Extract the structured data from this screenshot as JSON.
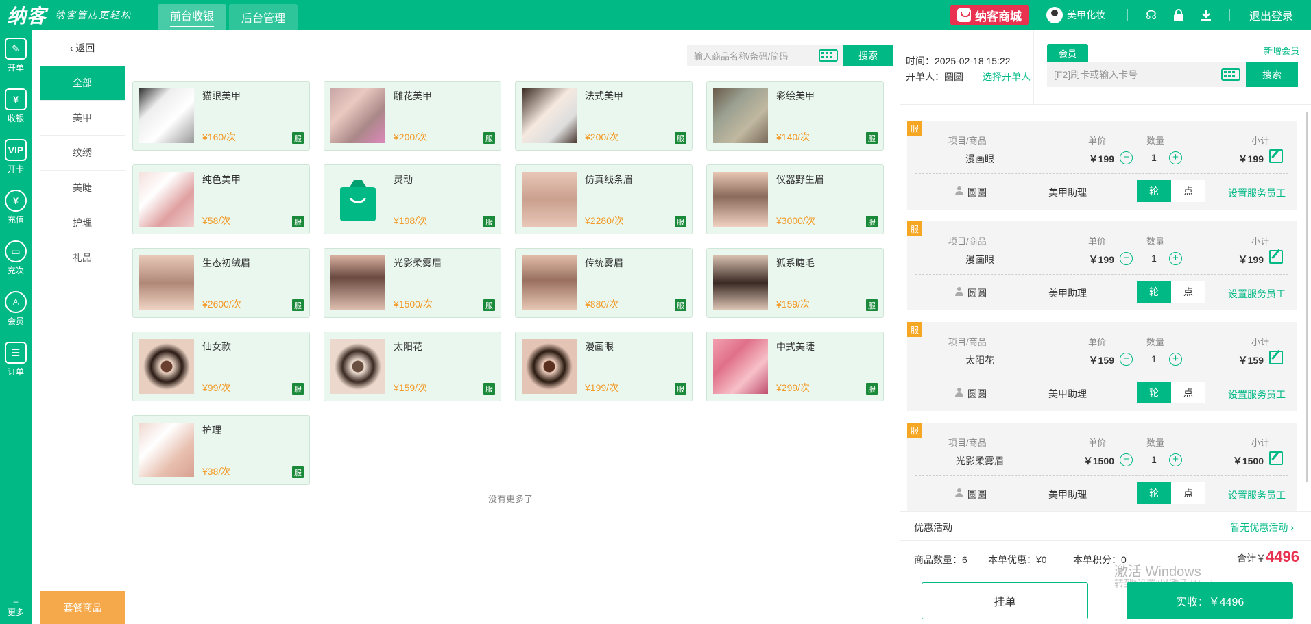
{
  "header": {
    "brand": "纳客",
    "slogan": "纳客管店更轻松",
    "tabs": [
      "前台收银",
      "后台管理"
    ],
    "mall": "纳客商城",
    "user": "美甲化妆",
    "logout": "退出登录"
  },
  "nav": [
    "开单",
    "收银",
    "开卡",
    "充值",
    "充次",
    "会员",
    "订单",
    "更多"
  ],
  "categories": {
    "back": "返回",
    "items": [
      "全部",
      "美甲",
      "纹绣",
      "美睫",
      "护理",
      "礼品"
    ],
    "combo": "套餐商品"
  },
  "search": {
    "placeholder": "输入商品名称/条码/简码",
    "button": "搜索"
  },
  "products": [
    {
      "name": "猫眼美甲",
      "price": "¥160/次",
      "tag": "服"
    },
    {
      "name": "雕花美甲",
      "price": "¥200/次",
      "tag": "服"
    },
    {
      "name": "法式美甲",
      "price": "¥200/次",
      "tag": "服"
    },
    {
      "name": "彩绘美甲",
      "price": "¥140/次",
      "tag": "服"
    },
    {
      "name": "纯色美甲",
      "price": "¥58/次",
      "tag": "服"
    },
    {
      "name": "灵动",
      "price": "¥198/次",
      "tag": "服"
    },
    {
      "name": "仿真线条眉",
      "price": "¥2280/次",
      "tag": "服"
    },
    {
      "name": "仪器野生眉",
      "price": "¥3000/次",
      "tag": "服"
    },
    {
      "name": "生态初绒眉",
      "price": "¥2600/次",
      "tag": "服"
    },
    {
      "name": "光影柔雾眉",
      "price": "¥1500/次",
      "tag": "服"
    },
    {
      "name": "传统雾眉",
      "price": "¥880/次",
      "tag": "服"
    },
    {
      "name": "狐系睫毛",
      "price": "¥159/次",
      "tag": "服"
    },
    {
      "name": "仙女款",
      "price": "¥99/次",
      "tag": "服"
    },
    {
      "name": "太阳花",
      "price": "¥159/次",
      "tag": "服"
    },
    {
      "name": "漫画眼",
      "price": "¥199/次",
      "tag": "服"
    },
    {
      "name": "中式美睫",
      "price": "¥299/次",
      "tag": "服"
    },
    {
      "name": "护理",
      "price": "¥38/次",
      "tag": "服"
    }
  ],
  "no_more": "没有更多了",
  "order_info": {
    "time": "时间：2025-02-18 15:22",
    "opener": "开单人：圆圆",
    "pick_opener": "选择开单人"
  },
  "member": {
    "tab": "会员",
    "new": "新增会员",
    "placeholder": "[F2]刷卡或输入卡号",
    "search": "搜索"
  },
  "order_headers": {
    "item": "项目/商品",
    "unit_price": "单价",
    "qty": "数量",
    "subtotal": "小计"
  },
  "orders": [
    {
      "badge": "服",
      "name": "漫画眼",
      "price": "￥199",
      "qty": "1",
      "subtotal": "￥199",
      "staff": "圆圆",
      "role": "美甲助理",
      "lun": "轮",
      "dian": "点",
      "set_staff": "设置服务员工"
    },
    {
      "badge": "服",
      "name": "漫画眼",
      "price": "￥199",
      "qty": "1",
      "subtotal": "￥199",
      "staff": "圆圆",
      "role": "美甲助理",
      "lun": "轮",
      "dian": "点",
      "set_staff": "设置服务员工"
    },
    {
      "badge": "服",
      "name": "太阳花",
      "price": "￥159",
      "qty": "1",
      "subtotal": "￥159",
      "staff": "圆圆",
      "role": "美甲助理",
      "lun": "轮",
      "dian": "点",
      "set_staff": "设置服务员工"
    },
    {
      "badge": "服",
      "name": "光影柔雾眉",
      "price": "￥1500",
      "qty": "1",
      "subtotal": "￥1500",
      "staff": "圆圆",
      "role": "美甲助理",
      "lun": "轮",
      "dian": "点",
      "set_staff": "设置服务员工"
    }
  ],
  "promo": {
    "label": "优惠活动",
    "value": "暂无优惠活动"
  },
  "summary": {
    "count": "商品数量：6",
    "discount": "本单优惠：¥0",
    "points": "本单积分：0",
    "total_label": "合计￥",
    "total": "4496"
  },
  "watermark": {
    "line1": "激活 Windows",
    "line2": "转到\"设置\"以激活 Windows。"
  },
  "actions": {
    "hold": "挂单",
    "pay": "实收：￥4496"
  },
  "colors": {
    "accent": "#00b985",
    "price": "#f29a27",
    "total": "#e8324f",
    "badge": "#f5a623"
  }
}
